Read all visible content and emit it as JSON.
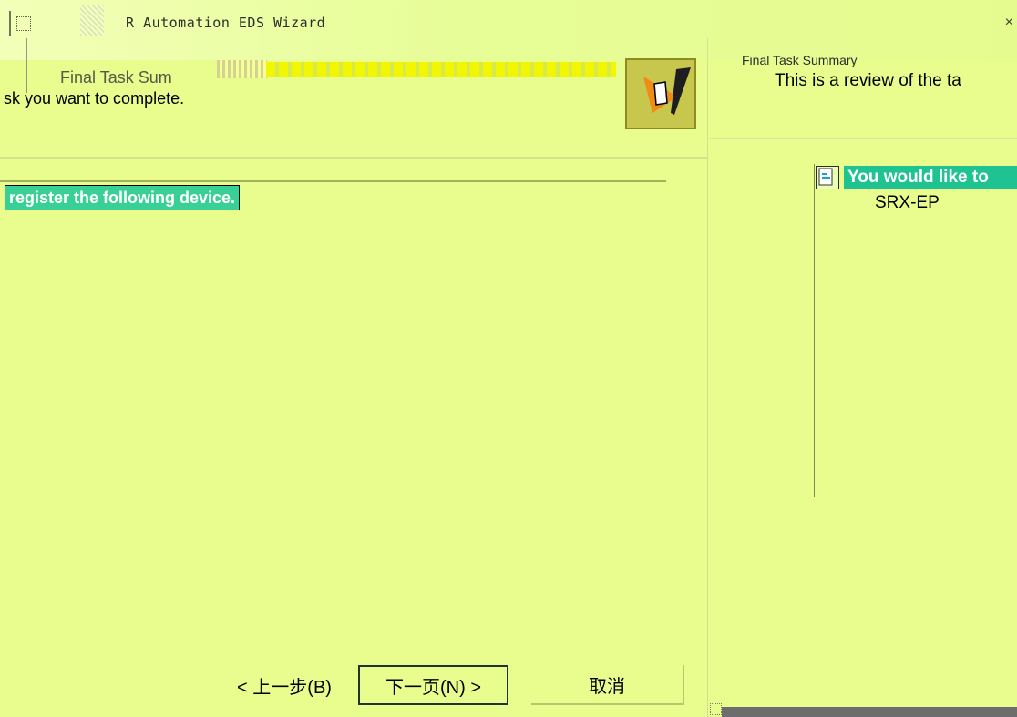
{
  "window": {
    "title": "Automation EDS Wizard",
    "title_prefix": "R"
  },
  "left_panel": {
    "header_title": "Final Task Sum",
    "header_subtitle": "sk you want to complete.",
    "highlight_text": "register the following device."
  },
  "right_panel": {
    "header_title": "Final Task Summary",
    "header_subtitle": "This is a review of the ta",
    "list_item": "You would like to",
    "device": "SRX-EP"
  },
  "buttons": {
    "back_label": "< 上一步(B)",
    "next_label": "下一页(N) >",
    "cancel_label": "取消"
  },
  "icons": {
    "wizard": "wizard-icon",
    "document": "document-icon",
    "app": "app-icon",
    "close": "close-icon"
  }
}
